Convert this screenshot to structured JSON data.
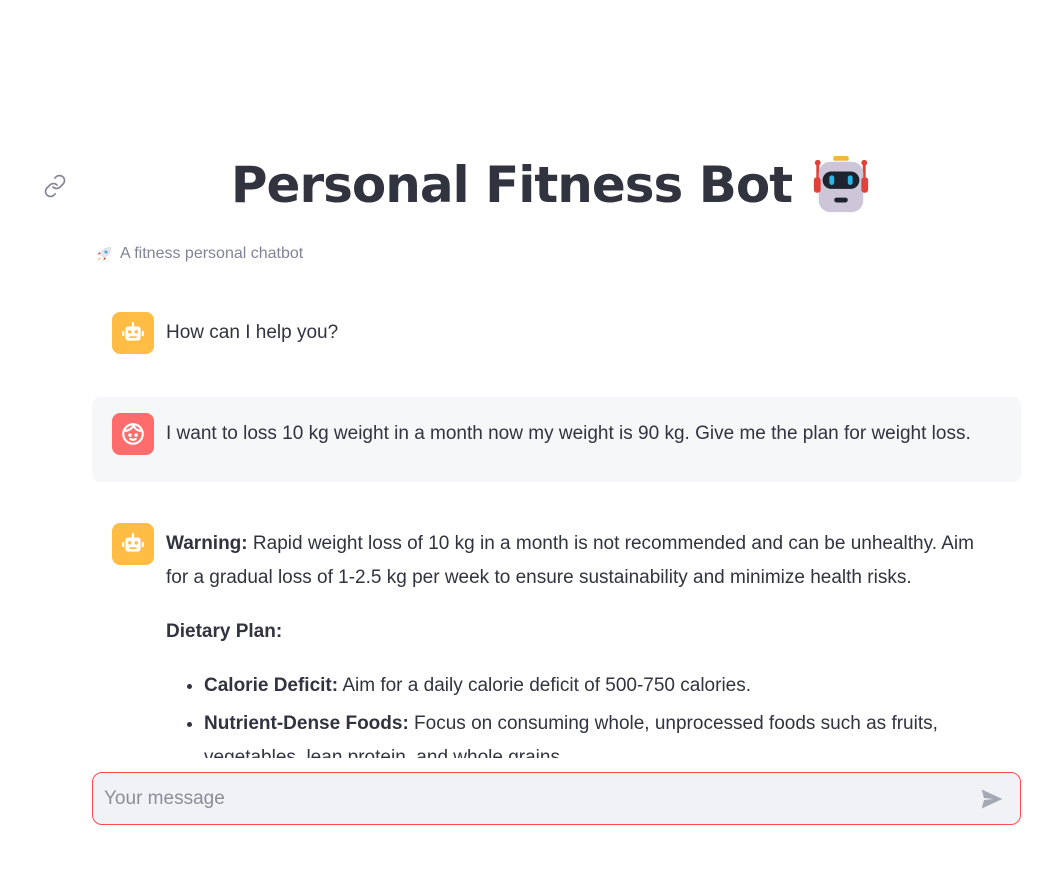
{
  "header": {
    "title": "Personal Fitness Bot",
    "title_emoji": "robot-face-icon",
    "caption_icon": "rocket-icon",
    "caption": "A fitness personal chatbot"
  },
  "messages": [
    {
      "role": "assistant",
      "avatar": "bot-icon",
      "text": "How can I help you?"
    },
    {
      "role": "user",
      "avatar": "user-face-icon",
      "text": "I want to loss 10 kg weight in a month now my weight is 90 kg. Give me the plan for weight loss."
    },
    {
      "role": "assistant",
      "avatar": "bot-icon",
      "warning_label": "Warning:",
      "warning_text": " Rapid weight loss of 10 kg in a month is not recommended and can be unhealthy. Aim for a gradual loss of 1-2.5 kg per week to ensure sustainability and minimize health risks.",
      "section_heading": "Dietary Plan:",
      "bullets": [
        {
          "label": "Calorie Deficit:",
          "text": " Aim for a daily calorie deficit of 500-750 calories."
        },
        {
          "label": "Nutrient-Dense Foods:",
          "text": " Focus on consuming whole, unprocessed foods such as fruits, vegetables, lean protein, and whole grains."
        }
      ]
    }
  ],
  "chat_input": {
    "placeholder": "Your message",
    "value": "",
    "send_icon": "send-icon"
  },
  "colors": {
    "accent": "#ff4b4b",
    "bot_avatar": "#ffbd45",
    "user_avatar": "#ff6c6c",
    "text": "#31333f",
    "caption": "#808495"
  }
}
